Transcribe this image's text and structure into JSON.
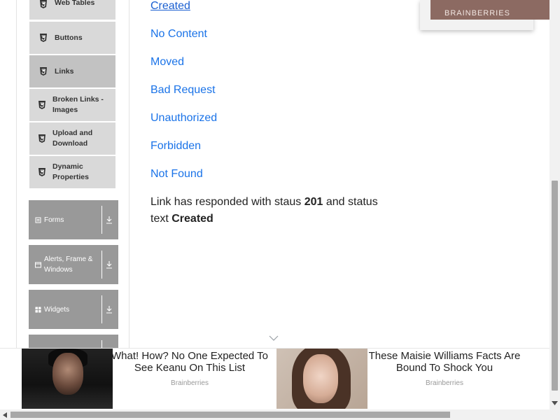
{
  "sidebar": {
    "elements_items": [
      {
        "label": "Web Tables",
        "icon": "html5-icon",
        "active": false
      },
      {
        "label": "Buttons",
        "icon": "html5-icon",
        "active": false
      },
      {
        "label": "Links",
        "icon": "html5-icon",
        "active": true
      },
      {
        "label": "Broken Links - Images",
        "icon": "html5-icon",
        "active": false
      },
      {
        "label": "Upload and Download",
        "icon": "html5-icon",
        "active": false
      },
      {
        "label": "Dynamic Properties",
        "icon": "html5-icon",
        "active": false
      }
    ],
    "groups": [
      {
        "label": "Forms",
        "icon": "form-icon"
      },
      {
        "label": "Alerts, Frame & Windows",
        "icon": "window-icon"
      },
      {
        "label": "Widgets",
        "icon": "grid-icon"
      }
    ]
  },
  "main": {
    "links": [
      "Created",
      "No Content",
      "Moved",
      "Bad Request",
      "Unauthorized",
      "Forbidden",
      "Not Found"
    ],
    "response": {
      "prefix": "Link has responded with staus",
      "status_code": "201",
      "middle": "and status text",
      "status_text": "Created"
    }
  },
  "top_ad": {
    "brand": "BRAINBERRIES"
  },
  "bottom_ad": {
    "items": [
      {
        "title": "What! How? No One Expected To See Keanu On This List",
        "source": "Brainberries"
      },
      {
        "title": "These Maisie Williams Facts Are Bound To Shock You",
        "source": "Brainberries"
      }
    ]
  },
  "colors": {
    "link": "#1a73e8",
    "menu_bg": "#d9d9d9",
    "menu_active_bg": "#c2c2c2",
    "group_bg": "#999999"
  }
}
